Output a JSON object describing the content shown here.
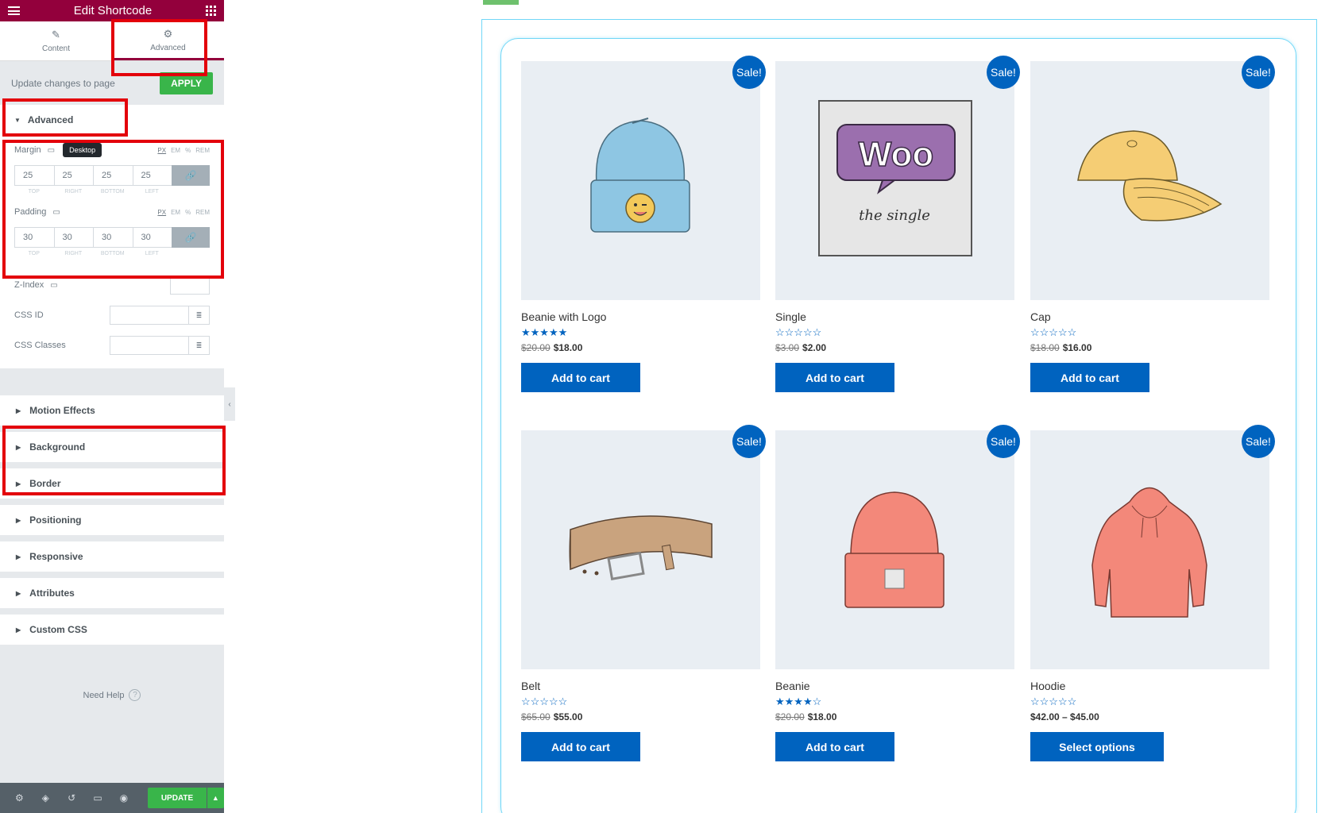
{
  "panel": {
    "title": "Edit Shortcode",
    "tabs": [
      {
        "label": "Content",
        "icon": "pencil-icon"
      },
      {
        "label": "Advanced",
        "icon": "gear-icon"
      }
    ],
    "update_text": "Update changes to page",
    "apply_label": "APPLY",
    "advanced_section": {
      "title": "Advanced",
      "margin": {
        "label": "Margin",
        "tooltip": "Desktop",
        "units": [
          "PX",
          "EM",
          "%",
          "REM"
        ],
        "values": [
          "25",
          "25",
          "25",
          "25"
        ],
        "labels": [
          "TOP",
          "RIGHT",
          "BOTTOM",
          "LEFT"
        ]
      },
      "padding": {
        "label": "Padding",
        "units": [
          "PX",
          "EM",
          "%",
          "REM"
        ],
        "values": [
          "30",
          "30",
          "30",
          "30"
        ],
        "labels": [
          "TOP",
          "RIGHT",
          "BOTTOM",
          "LEFT"
        ]
      },
      "zindex_label": "Z-Index",
      "css_id_label": "CSS ID",
      "css_classes_label": "CSS Classes"
    },
    "sections": [
      "Motion Effects",
      "Background",
      "Border",
      "Positioning",
      "Responsive",
      "Attributes",
      "Custom CSS"
    ],
    "help_label": "Need Help",
    "update_label": "UPDATE"
  },
  "products": [
    {
      "name": "Beanie with Logo",
      "sale": "Sale!",
      "old_price": "$20.00",
      "price": "$18.00",
      "rating": 5,
      "button": "Add to cart",
      "image": "beanie-logo"
    },
    {
      "name": "Single",
      "sale": "Sale!",
      "old_price": "$3.00",
      "price": "$2.00",
      "rating": 0,
      "button": "Add to cart",
      "image": "woo-single"
    },
    {
      "name": "Cap",
      "sale": "Sale!",
      "old_price": "$18.00",
      "price": "$16.00",
      "rating": 0,
      "button": "Add to cart",
      "image": "cap"
    },
    {
      "name": "Belt",
      "sale": "Sale!",
      "old_price": "$65.00",
      "price": "$55.00",
      "rating": 0,
      "button": "Add to cart",
      "image": "belt"
    },
    {
      "name": "Beanie",
      "sale": "Sale!",
      "old_price": "$20.00",
      "price": "$18.00",
      "rating": 4,
      "button": "Add to cart",
      "image": "beanie"
    },
    {
      "name": "Hoodie",
      "sale": "Sale!",
      "old_price": "",
      "price": "$42.00 – $45.00",
      "rating": 0,
      "button": "Select options",
      "image": "hoodie"
    }
  ],
  "woo_card": {
    "logo": "Woo",
    "caption": "the single"
  },
  "colors": {
    "brand": "#93003c",
    "accent": "#0063bf",
    "apply": "#39b54a",
    "highlight": "#e3000b"
  }
}
